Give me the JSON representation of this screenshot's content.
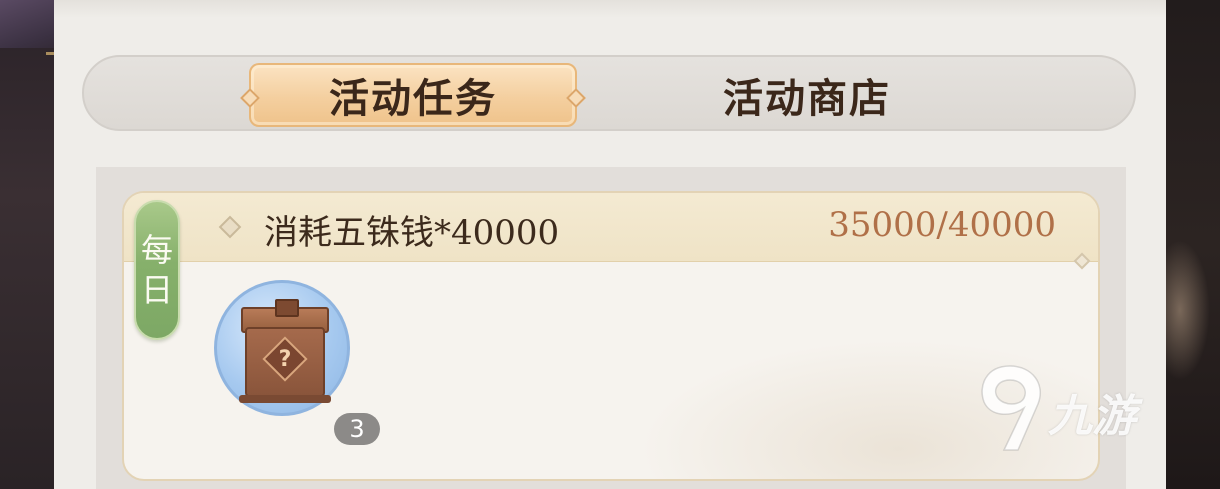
{
  "tabs": [
    {
      "label": "活动任务",
      "active": true
    },
    {
      "label": "活动商店",
      "active": false
    }
  ],
  "task": {
    "badge": [
      "每",
      "日"
    ],
    "title": "消耗五铢钱*40000",
    "progress": "35000/40000",
    "reward": {
      "icon": "mystery-chest-icon",
      "glyph": "?",
      "count": "3"
    }
  },
  "watermark": {
    "text": "九游"
  },
  "colors": {
    "active_tab": "#f4cf9f",
    "progress_text": "#b07048",
    "badge_green": "#86b06b",
    "reward_circle": "#a6c9ef"
  }
}
